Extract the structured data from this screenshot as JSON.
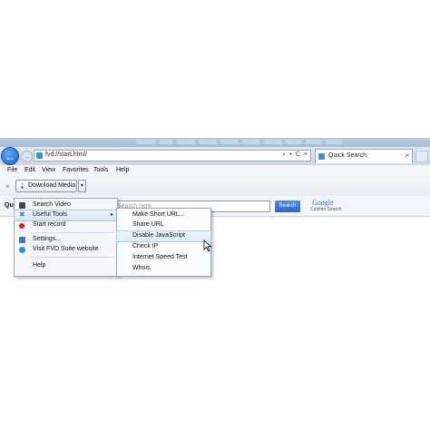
{
  "browser": {
    "url": "fvd://start.html/",
    "address_controls": "⌕ ▾ C ×",
    "tab": {
      "title": "Quick Search"
    }
  },
  "menubar": {
    "items": [
      "File",
      "Edit",
      "View",
      "Favorites",
      "Tools",
      "Help"
    ]
  },
  "toolbar": {
    "close": "×",
    "download_label": "Download Media",
    "dropdown": "▾"
  },
  "searchbar": {
    "label": "Qu",
    "placeholder": "Search here",
    "button": "Search",
    "brand": "Google",
    "brand_sub": "Custom Search"
  },
  "main_menu": {
    "items": [
      {
        "label": "Search Video",
        "icon": "film-icon",
        "color": "#444444"
      },
      {
        "label": "Useful Tools",
        "icon": "tools-icon",
        "color": "#4a7cc0",
        "submenu": true,
        "highlighted": true
      },
      {
        "label": "Start record",
        "icon": "record-icon",
        "color": "#cc2222"
      },
      {
        "label": "Settings...",
        "icon": "settings-icon",
        "color": "#3c78c8"
      },
      {
        "label": "Visit FVD Suite website",
        "icon": "globe-icon",
        "color": "#2e8fd6"
      },
      {
        "label": "Help",
        "icon": "",
        "color": ""
      }
    ],
    "arrow": "▸"
  },
  "sub_menu": {
    "items": [
      {
        "label": "Make Short URL..."
      },
      {
        "label": "Share URL"
      },
      {
        "label": "Disable JavaScript",
        "highlighted": true
      },
      {
        "label": "Check IP"
      },
      {
        "label": "Internet Speed Test"
      },
      {
        "label": "Whois"
      }
    ]
  },
  "colors": {
    "accent": "#2e66be",
    "titlebar": "#b9c9df",
    "highlight": "#d6e6f7"
  }
}
